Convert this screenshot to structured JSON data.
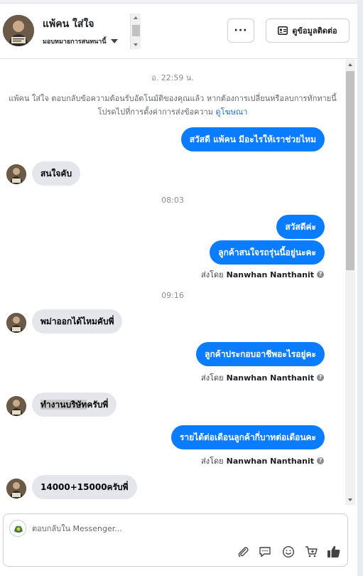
{
  "header": {
    "contact_name": "แพ้คน ใส่ใจ",
    "assign_label": "มอบหมายการสนทนานี้",
    "more_label": "···",
    "info_button_label": "ดูข้อมูลติดต่อ"
  },
  "thread": {
    "timestamp_1": "อ. 22:59 น.",
    "system_notice": "แพ้คน ใส่ใจ ตอบกลับข้อความต้อนรับอัตโนมัติของคุณแล้ว หากต้องการเปลี่ยนหรือลบการทักทายนี้ โปรดไปที่การตั้งค่าการส่งข้อความ",
    "system_notice_link": "ดูโฆษณา",
    "msg_out_1": "สวัสดี แพ้คน มีอะไรให้เราช่วยไหม",
    "msg_in_1": "สนใจคับ",
    "timestamp_2": "08:03",
    "msg_out_2": "สวัสดีค่ะ",
    "msg_out_3": "ลูกค้าสนใจรถรุ่นนี้อยู่นะคะ",
    "sent_by_prefix": "ส่งโดย",
    "sender_name": "Nanwhan Nanthanit",
    "timestamp_3": "09:16",
    "msg_in_2": "พม่าออกได้ไหมคับพี่",
    "msg_out_4": "ลูกค้าประกอบอาชีพอะไรอยู่คะ",
    "msg_in_3_highlight": "ทำงานบริษัท",
    "msg_in_3_rest": "ครับพี่",
    "msg_out_5": "รายได้ต่อเดือนลูกค้ากี่บาทต่อเดือนคะ",
    "msg_in_4": "14000+15000ครับพี่"
  },
  "composer": {
    "placeholder": "ตอบกลับใน Messenger..."
  },
  "colors": {
    "outgoing_bubble": "#0a7cff",
    "incoming_bubble": "#e4e6eb",
    "link": "#1a6fd4"
  },
  "icons": [
    "attach-icon",
    "chat-icon",
    "emoji-icon",
    "cart-icon",
    "thumbs-up-icon"
  ]
}
